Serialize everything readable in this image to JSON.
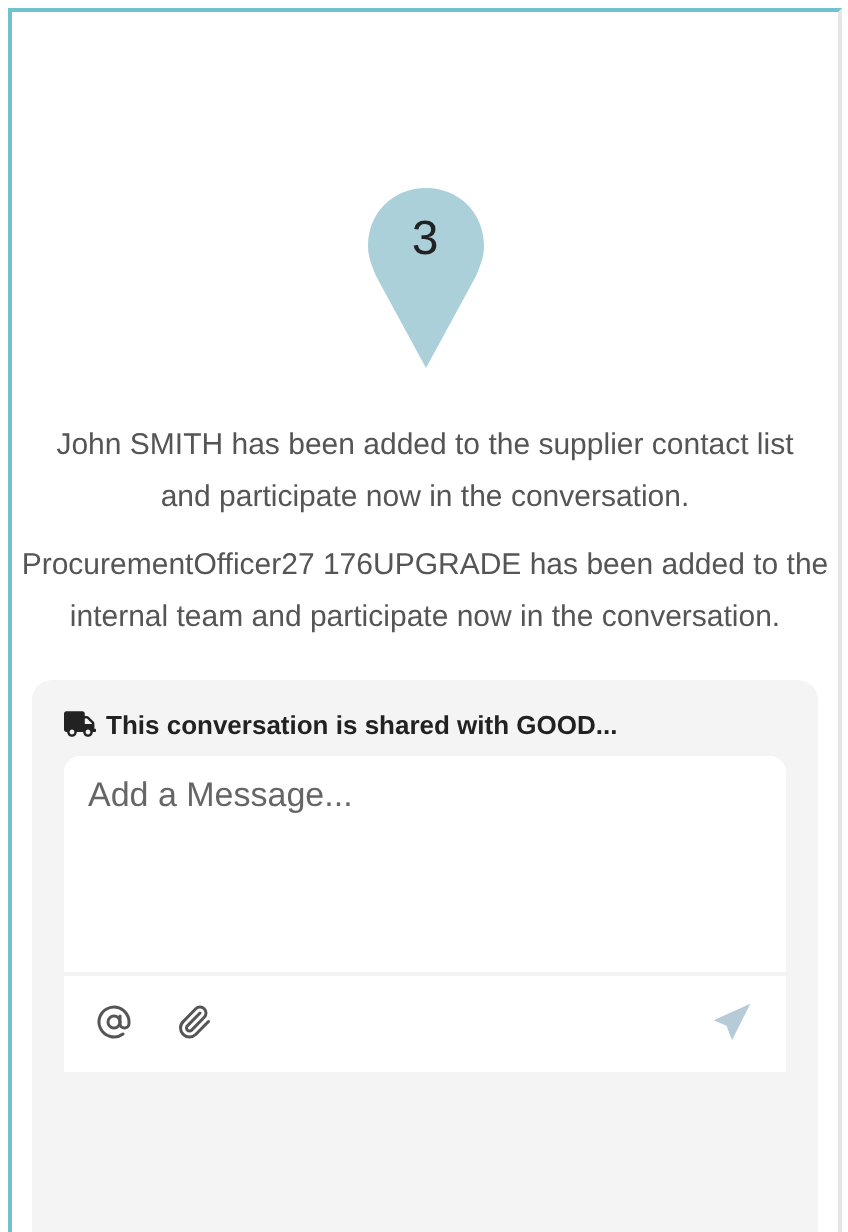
{
  "marker": {
    "count": "3"
  },
  "messages": [
    {
      "text": "John SMITH has been added to the supplier contact list and participate now in the conversation."
    },
    {
      "text": "ProcurementOfficer27 176UPGRADE has been added to the internal team and participate now in the conversation."
    }
  ],
  "composer": {
    "shared_notice": "This conversation is shared with GOOD...",
    "placeholder": "Add a Message...",
    "send_disabled": true
  }
}
